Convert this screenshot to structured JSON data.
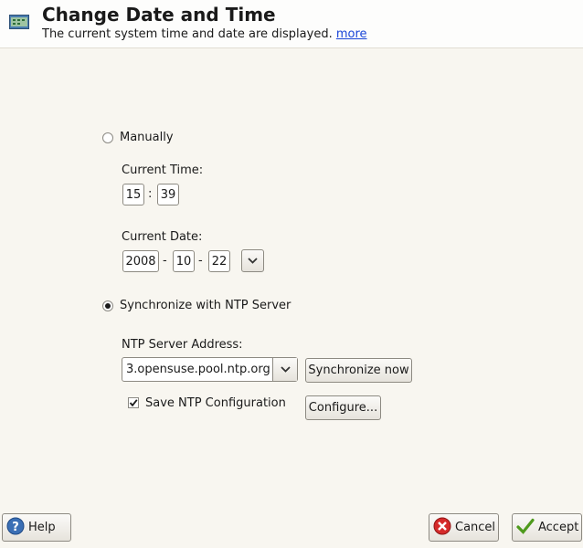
{
  "header": {
    "title": "Change Date and Time",
    "subtitle": "The current system time and date are displayed.",
    "more_link": "more",
    "icon": "clock-calendar-icon"
  },
  "manual": {
    "radio_label": "Manually",
    "selected": false,
    "time_label": "Current Time:",
    "hour": "15",
    "minute": "39",
    "time_sep": ":",
    "date_label": "Current Date:",
    "year": "2008",
    "month": "10",
    "day": "22",
    "date_sep": "-",
    "date_picker_icon": "chevron-down-icon"
  },
  "ntp": {
    "radio_label": "Synchronize with NTP Server",
    "selected": true,
    "address_label": "NTP Server Address:",
    "address_value": "3.opensuse.pool.ntp.org",
    "sync_button": "Synchronize now",
    "save_label": "Save NTP Configuration",
    "save_checked": true,
    "configure_button": "Configure..."
  },
  "footer": {
    "help_button": "Help",
    "cancel_button": "Cancel",
    "accept_button": "Accept",
    "help_icon": "help-icon",
    "cancel_icon": "cancel-icon",
    "accept_icon": "checkmark-icon"
  }
}
